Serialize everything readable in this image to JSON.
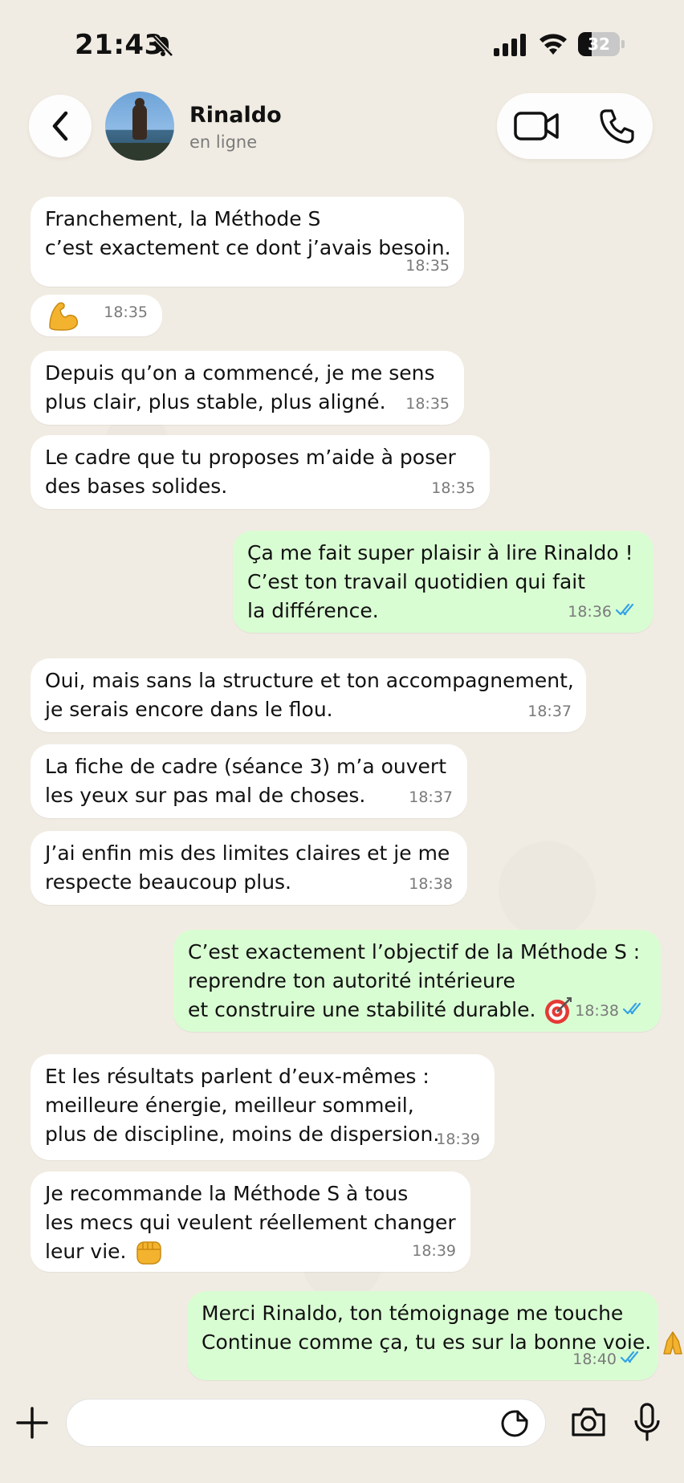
{
  "status_bar": {
    "time": "21:43",
    "battery": "32",
    "battery_level": 0.32
  },
  "header": {
    "contact_name": "Rinaldo",
    "contact_status": "en ligne",
    "icons": [
      "chevron-left-icon",
      "video-call-icon",
      "phone-icon"
    ]
  },
  "messages": [
    {
      "dir": "in",
      "text": "Franchement, la Méthode S\nc’est exactement ce dont j’avais besoin.",
      "time": "18:35"
    },
    {
      "dir": "in",
      "text": "",
      "emoji": "flexed-biceps",
      "time": "18:35"
    },
    {
      "dir": "in",
      "text": "Depuis qu’on a commencé, je me sens\nplus clair, plus stable, plus aligné.",
      "time": "18:35"
    },
    {
      "dir": "in",
      "text": "Le cadre que tu proposes m’aide à poser\ndes bases solides.",
      "time": "18:35"
    },
    {
      "dir": "out",
      "text": "Ça me fait super plaisir à lire Rinaldo !\nC’est ton travail quotidien qui fait\nla différence.",
      "time": "18:36",
      "read": true
    },
    {
      "dir": "in",
      "text": "Oui, mais sans la structure et ton accompagnement,\nje serais encore dans le flou.",
      "time": "18:37"
    },
    {
      "dir": "in",
      "text": "La fiche de cadre (séance 3) m’a ouvert\nles yeux sur pas mal de choses.",
      "time": "18:37"
    },
    {
      "dir": "in",
      "text": "J’ai enfin mis des limites claires et je me\nrespecte beaucoup plus.",
      "time": "18:38"
    },
    {
      "dir": "out",
      "text": "C’est exactement l’objectif de la Méthode S :\nreprendre ton autorité intérieure\net construire une stabilité durable.",
      "emoji": "direct-hit",
      "time": "18:38",
      "read": true
    },
    {
      "dir": "in",
      "text": "Et les résultats parlent d’eux-mêmes :\nmeilleure énergie, meilleur sommeil,\nplus de discipline, moins de dispersion.",
      "time": "18:39"
    },
    {
      "dir": "in",
      "text": "Je recommande la Méthode S à tous\nles mecs qui veulent réellement changer\nleur vie.",
      "emoji": "oncoming-fist",
      "time": "18:39"
    },
    {
      "dir": "out",
      "text": "Merci Rinaldo, ton témoignage me touche\nContinue comme ça, tu es sur la bonne voie.",
      "emoji": "folded-hands",
      "time": "18:40",
      "read": true
    }
  ],
  "input_bar": {
    "placeholder": "",
    "icons": [
      "plus-icon",
      "sticker-icon",
      "camera-icon",
      "microphone-icon"
    ]
  },
  "colors": {
    "incoming": "#ffffff",
    "outgoing": "#d9fdd3",
    "read_check": "#34a3e6",
    "background": "#f1ece3"
  }
}
